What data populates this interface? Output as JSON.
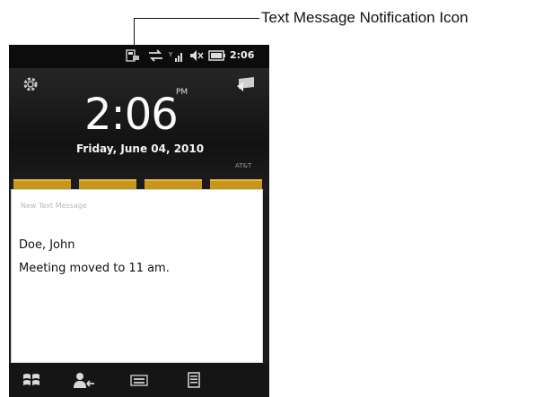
{
  "callout": {
    "label": "Text Message Notification Icon"
  },
  "status_bar": {
    "time": "2:06",
    "icons": [
      "text-message-notification-icon",
      "data-sync-icon",
      "signal-strength-icon",
      "speaker-muted-icon",
      "battery-icon"
    ]
  },
  "home": {
    "time": "2:06",
    "ampm": "PM",
    "date": "Friday, June 04, 2010",
    "carrier": "AT&T",
    "icons": [
      "settings-gear-icon",
      "start-flag-icon"
    ]
  },
  "popup": {
    "header": "New Text Message",
    "sender": "Doe, John",
    "body": "Meeting moved to 11 am."
  },
  "softkeys": [
    "windows-start-icon",
    "contacts-icon",
    "keyboard-icon",
    "menu-list-icon"
  ],
  "colors": {
    "tile_gold": "#c9961c",
    "background": "#1a1a1a",
    "popup": "#ffffff"
  }
}
